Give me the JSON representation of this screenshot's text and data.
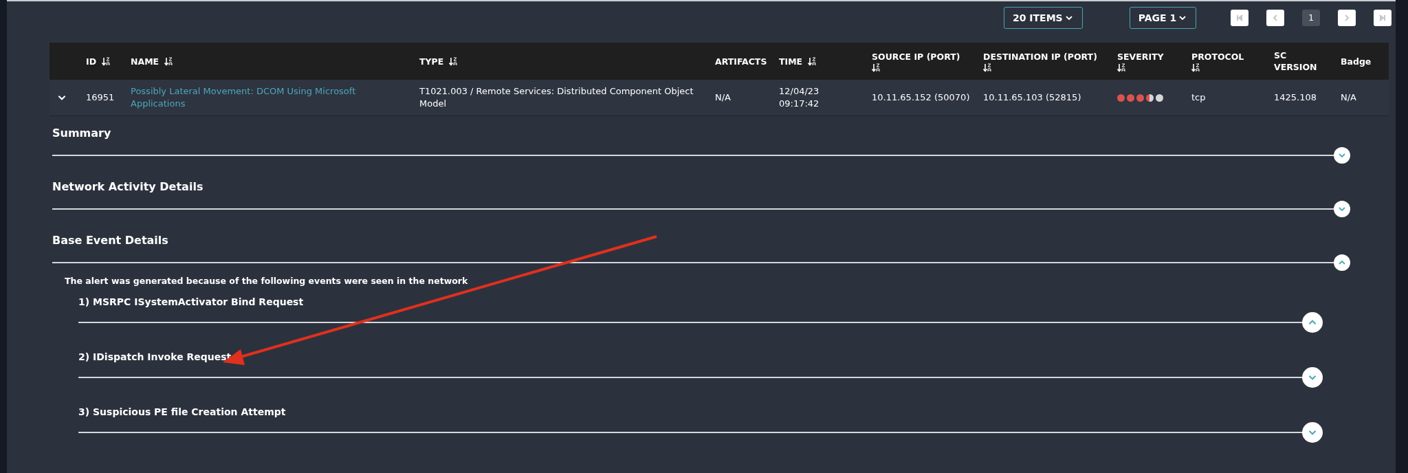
{
  "toolbar": {
    "items_per_page": "20 ITEMS",
    "page_select": "PAGE 1",
    "pages": [
      {
        "label": "1",
        "selected": true
      }
    ]
  },
  "table": {
    "columns": [
      {
        "label": "ID",
        "sortable": true
      },
      {
        "label": "NAME",
        "sortable": true
      },
      {
        "label": "TYPE",
        "sortable": true
      },
      {
        "label": "ARTIFACTS",
        "sortable": false
      },
      {
        "label": "TIME",
        "sortable": true
      },
      {
        "label": "SOURCE IP (PORT)",
        "sortable": true
      },
      {
        "label": "DESTINATION IP (PORT)",
        "sortable": true
      },
      {
        "label": "SEVERITY",
        "sortable": true
      },
      {
        "label": "PROTOCOL",
        "sortable": true
      },
      {
        "label": "SC VERSION",
        "sortable": false
      },
      {
        "label": "Badge",
        "sortable": false
      }
    ],
    "rows": [
      {
        "expanded": true,
        "id": "16951",
        "name": "Possibly Lateral Movement: DCOM Using Microsoft Applications",
        "type": "T1021.003 / Remote Services: Distributed Component Object Model",
        "artifacts": "N/A",
        "time": "12/04/23 09:17:42",
        "source_ip": "10.11.65.152 (50070)",
        "destination_ip": "10.11.65.103 (52815)",
        "severity": {
          "stars": 3.5
        },
        "protocol": "tcp",
        "sc_version": "1425.108",
        "badge": "N/A"
      }
    ]
  },
  "sections": [
    {
      "title": "Summary",
      "expanded": false
    },
    {
      "title": "Network Activity Details",
      "expanded": false
    },
    {
      "title": "Base Event Details",
      "expanded": true,
      "note": "The alert was generated because of the following events were seen in the network",
      "events": [
        {
          "title": "1) MSRPC ISystemActivator Bind Request",
          "expanded": true
        },
        {
          "title": "2) IDispatch Invoke Request",
          "expanded": false
        },
        {
          "title": "3) Suspicious PE file Creation Attempt",
          "expanded": false
        }
      ]
    }
  ]
}
